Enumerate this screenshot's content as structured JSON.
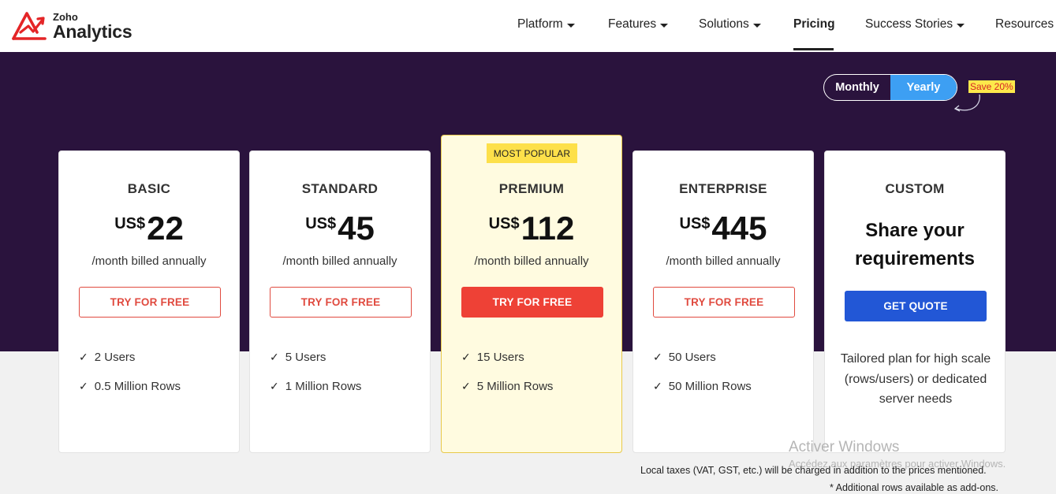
{
  "brand": {
    "small": "Zoho",
    "big": "Analytics",
    "accent": "#e42527"
  },
  "nav": {
    "items": [
      {
        "label": "Platform",
        "dropdown": true
      },
      {
        "label": "Features",
        "dropdown": true
      },
      {
        "label": "Solutions",
        "dropdown": true
      },
      {
        "label": "Pricing",
        "dropdown": false,
        "active": true
      },
      {
        "label": "Success Stories",
        "dropdown": true
      },
      {
        "label": "Resources",
        "dropdown": false
      }
    ]
  },
  "billing_toggle": {
    "monthly": "Monthly",
    "yearly": "Yearly",
    "selected": "Yearly",
    "save_badge": "Save 20%"
  },
  "plans": [
    {
      "name": "BASIC",
      "currency": "US$",
      "price": "22",
      "billing": "/month billed annually",
      "cta": "TRY FOR FREE",
      "features": [
        "2 Users",
        "0.5 Million Rows"
      ]
    },
    {
      "name": "STANDARD",
      "currency": "US$",
      "price": "45",
      "billing": "/month billed annually",
      "cta": "TRY FOR FREE",
      "features": [
        "5 Users",
        "1 Million Rows"
      ]
    },
    {
      "name": "PREMIUM",
      "badge": "MOST POPULAR",
      "currency": "US$",
      "price": "112",
      "billing": "/month billed annually",
      "cta": "TRY FOR FREE",
      "features": [
        "15 Users",
        "5 Million Rows"
      ]
    },
    {
      "name": "ENTERPRISE",
      "currency": "US$",
      "price": "445",
      "billing": "/month billed annually",
      "cta": "TRY FOR FREE",
      "features": [
        "50 Users",
        "50 Million Rows"
      ]
    },
    {
      "name": "CUSTOM",
      "headline": "Share your requirements",
      "cta": "GET QUOTE",
      "description": "Tailored plan for high scale (rows/users) or dedicated server needs"
    }
  ],
  "notes": {
    "taxes": "Local taxes (VAT, GST, etc.) will be charged in addition to the prices mentioned.",
    "addons": "* Additional rows available as add-ons."
  },
  "windows_watermark": {
    "title": "Activer Windows",
    "subtitle": "Accédez aux paramètres pour activer Windows."
  },
  "colors": {
    "hero_bg": "#2a133d",
    "toggle_selected": "#3d9ff3",
    "cta_red": "#ee4136",
    "quote_blue": "#2257d6",
    "popular_bg": "#fffbe0",
    "badge_yellow": "#fde04a"
  }
}
